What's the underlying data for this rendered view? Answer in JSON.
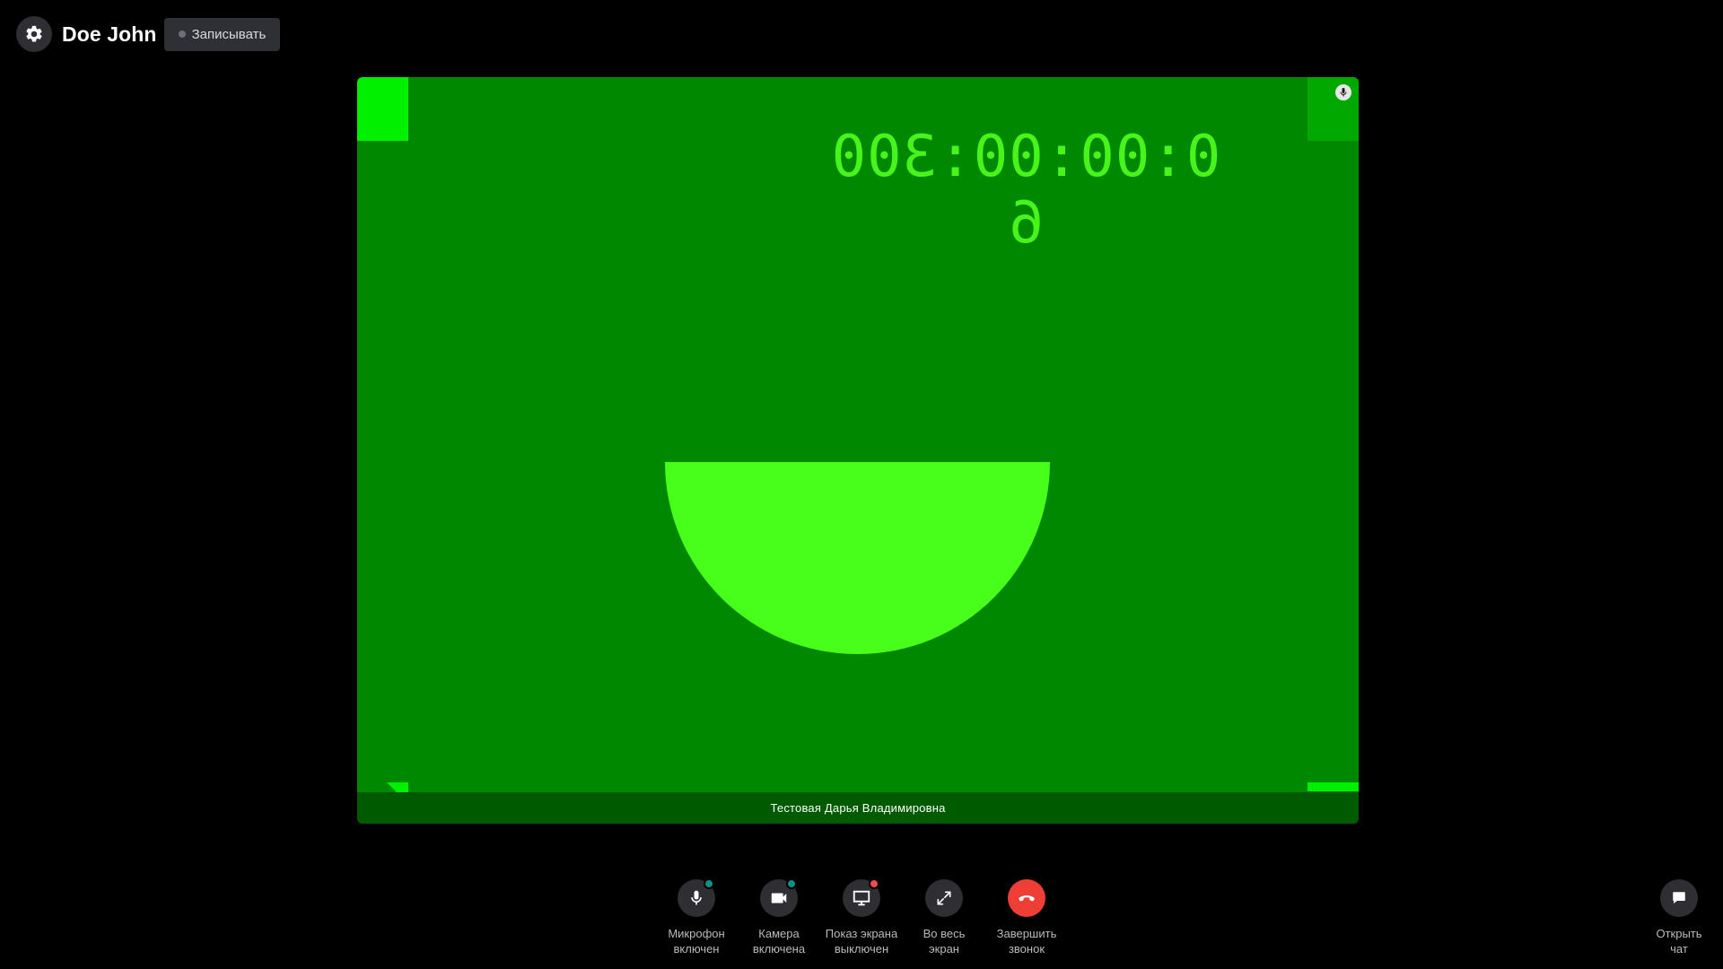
{
  "header": {
    "user_name": "Doe John",
    "record_label": "Записывать"
  },
  "video": {
    "timecode": "0:00:00:300 6",
    "participant_name": "Тестовая Дарья Владимировна",
    "colors": {
      "background": "#018801",
      "shape": "#47ff1b",
      "timecode": "#47f51b",
      "name_bar": "#005a00"
    }
  },
  "controls": {
    "microphone": {
      "label": "Микрофон\nвключен",
      "status": "on",
      "status_color": "#0f8f85",
      "icon": "microphone-icon"
    },
    "camera": {
      "label": "Камера\nвключена",
      "status": "on",
      "status_color": "#0f8f85",
      "icon": "video-camera-icon"
    },
    "screen_share": {
      "label": "Показ экрана\nвыключен",
      "status": "off",
      "status_color": "#ef4b4b",
      "icon": "monitor-icon"
    },
    "fullscreen": {
      "label": "Во весь\nэкран",
      "icon": "expand-icon"
    },
    "end_call": {
      "label": "Завершить\nзвонок",
      "icon": "hang-up-icon",
      "color": "#ef3e36"
    },
    "open_chat": {
      "label": "Открыть\nчат",
      "icon": "chat-bubble-icon"
    }
  }
}
